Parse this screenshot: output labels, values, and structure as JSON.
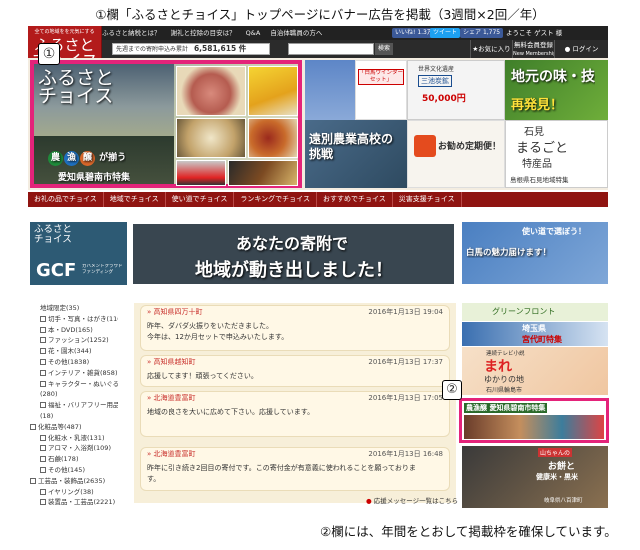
{
  "title": "①欄「ふるさとチョイス」トップページにバナー広告を掲載（3週間×2回／年）",
  "footer_note": "②欄には、年間をとおして掲載枠を確保しています。",
  "markers": {
    "m1": "①",
    "m2": "②"
  },
  "topbar": {
    "items": [
      "ふるさと納税とは？",
      "謝礼と控除の目安は？",
      "Q&A",
      "自治体職員の方へ",
      "いいね!",
      "ツイート",
      "シェア"
    ],
    "counts": {
      "like": "1.3万",
      "share": "1,775"
    },
    "guest": "ようこそ ゲスト 様"
  },
  "logo": {
    "line1": "ふるさと",
    "line2": "チョイス",
    "tagline": "全ての地域をを元気にする"
  },
  "header": {
    "donation_label": "先週までの寄附申込み累計",
    "donation_value": "6,581,615 件",
    "search_button": "検索",
    "icons": [
      {
        "label": "お気に入り",
        "sub": "My Favorites"
      },
      {
        "label": "無料会員登録",
        "sub": "New Membership"
      },
      {
        "label": "ログイン",
        "sub": "Login"
      }
    ]
  },
  "main_banner": {
    "title1": "ふるさと",
    "title2": "チョイス",
    "badges": [
      {
        "text": "農",
        "color": "#1f8a3b"
      },
      {
        "text": "漁",
        "color": "#1e6fbf"
      },
      {
        "text": "醸",
        "color": "#d8662a"
      }
    ],
    "caption_tail": "が揃う",
    "subtitle": "愛知県碧南市特集"
  },
  "right_tiles": {
    "winter_set": "「白馬ウインターセット」",
    "coal": "三池炭鉱",
    "coal_line2": "世界文化遺産",
    "coal_prize": "50,000円",
    "local": "地元の味・技",
    "local2": "再発見！",
    "school": "遠別農業高校の挑戦",
    "regular": "お勧め定期便！",
    "iwami1": "石見",
    "iwami2": "まるごと",
    "iwami3": "特産品",
    "iwami4": "島根県石見地域特集"
  },
  "navbar": {
    "items": [
      "お礼の品でチョイス",
      "地域でチョイス",
      "使い道でチョイス",
      "ランキングでチョイス",
      "おすすめでチョイス",
      "災害支援チョイス"
    ]
  },
  "gcf": {
    "line1": "ふるさと",
    "line2": "チョイス",
    "logo": "GCF",
    "sub": "ガバメントクラウドファンディング"
  },
  "mid_banner": {
    "line1": "あなたの寄附で",
    "line2": "地域が動き出しました！"
  },
  "right_banner": {
    "line1": "使い道で選ぼう！",
    "line2": "白馬の魅力届けます！"
  },
  "categories": {
    "items": [
      {
        "label": "地域限定(35)",
        "checkbox": false
      },
      {
        "label": "切手・写真・はがき(110)",
        "checkbox": true
      },
      {
        "label": "本・DVD(165)",
        "checkbox": true
      },
      {
        "label": "ファッション(1252)",
        "checkbox": true
      },
      {
        "label": "花・園木(344)",
        "checkbox": true
      },
      {
        "label": "その他(1838)",
        "checkbox": true
      },
      {
        "label": "インテリア・雑貨(858)",
        "checkbox": true
      },
      {
        "label": "キャラクター・ぬいぐるみ",
        "checkbox": true
      },
      {
        "label": "(280)",
        "checkbox": false
      },
      {
        "label": "福祉・バリアフリー用品",
        "checkbox": true
      },
      {
        "label": "(18)",
        "checkbox": false
      },
      {
        "label": "化粧品等(487)",
        "checkbox": true
      },
      {
        "label": "化粧水・乳液(131)",
        "checkbox": true
      },
      {
        "label": "アロマ・入浴剤(109)",
        "checkbox": true
      },
      {
        "label": "石鹸(178)",
        "checkbox": true
      },
      {
        "label": "その他(145)",
        "checkbox": true
      },
      {
        "label": "工芸品・装飾品(2635)",
        "checkbox": true
      },
      {
        "label": "イヤリング(38)",
        "checkbox": true
      },
      {
        "label": "装置品・工芸品(2221)",
        "checkbox": true
      }
    ]
  },
  "messages": [
    {
      "town": "» 高知県四万十町",
      "date": "2016年1月13日 19:04",
      "text": [
        "昨年、ダバダ火振りをいただきました。",
        "今年は、12か月セットで申込みいたします。"
      ]
    },
    {
      "town": "» 高知県越知町",
      "date": "2016年1月13日 17:37",
      "text": [
        "応援してます！頑張ってください。"
      ]
    },
    {
      "town": "» 北海道豊富町",
      "date": "2016年1月13日 17:05",
      "text": [
        "地域の良さを大いに広めて下さい。応援しています。"
      ]
    },
    {
      "town": "» 北海道豊富町",
      "date": "2016年1月13日 16:48",
      "text": [
        "昨年に引き続き2回目の寄付です。この寄付金が有意義に使われることを願っておりま",
        "す。"
      ]
    }
  ],
  "messages_footer": "応援メッセージ一覧はこちら",
  "side_banners": {
    "green": "グリーンフロント",
    "saitama": "埼玉県",
    "saitama2": "宮代町特集",
    "mare": "まれ",
    "mare2": "ゆかりの地",
    "mare3": "石川県輪島市",
    "mare_top": "連続テレビ小説",
    "hekinan": "愛知県碧南市特集",
    "yamachan": "山ちゃんの",
    "omochi": "お餅と",
    "omochi2": "健康米・黒米",
    "omochi3": "岐阜県八百津町"
  }
}
